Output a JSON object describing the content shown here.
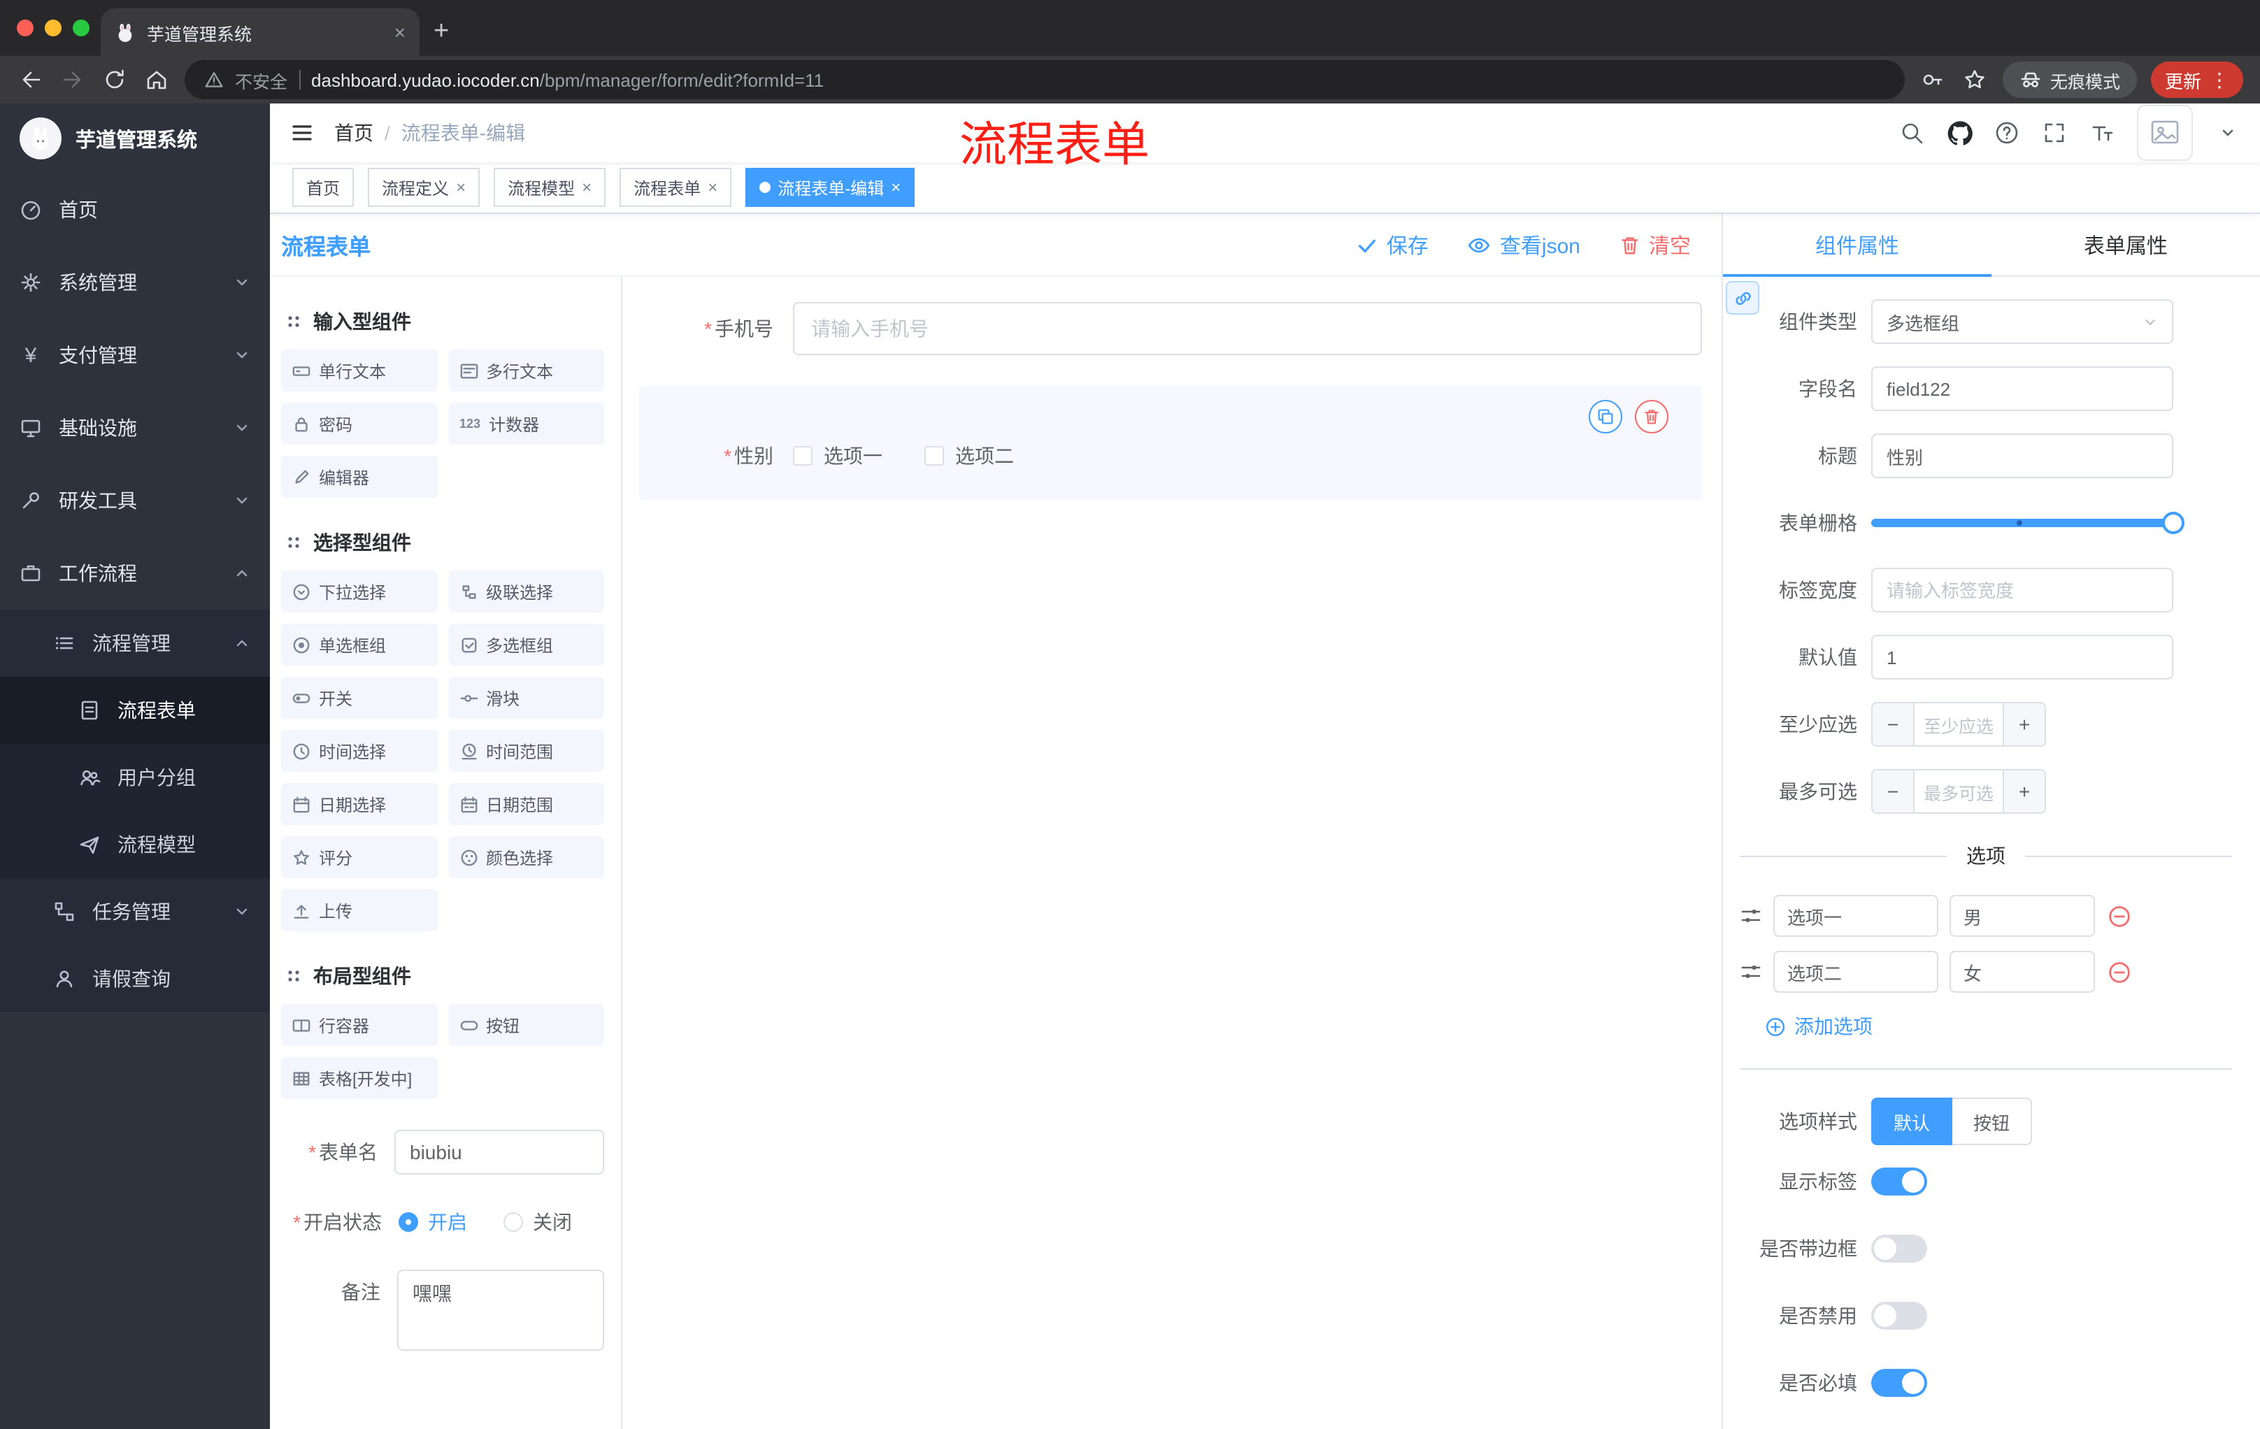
{
  "glyphs": {
    "close": "×",
    "plus": "+",
    "menu": "⋮",
    "minus": "−",
    "required": "*",
    "question": "?"
  },
  "colors": {
    "accent": "#409eff",
    "danger": "#f56c6c",
    "annotation_red": "#fb2016"
  },
  "browser": {
    "tab_title": "芋道管理系统",
    "security_label": "不安全",
    "url_host": "dashboard.yudao.iocoder.cn",
    "url_path": "/bpm/manager/form/edit?formId=11",
    "incognito_label": "无痕模式",
    "update_label": "更新"
  },
  "sidebar": {
    "logo_title": "芋道管理系统",
    "items": [
      {
        "label": "首页"
      },
      {
        "label": "系统管理"
      },
      {
        "label": "支付管理"
      },
      {
        "label": "基础设施"
      },
      {
        "label": "研发工具"
      },
      {
        "label": "工作流程"
      },
      {
        "label": "流程管理"
      },
      {
        "label": "流程表单"
      },
      {
        "label": "用户分组"
      },
      {
        "label": "流程模型"
      },
      {
        "label": "任务管理"
      },
      {
        "label": "请假查询"
      }
    ]
  },
  "header": {
    "breadcrumb_home": "首页",
    "breadcrumb_separator": "/",
    "breadcrumb_current": "流程表单-编辑",
    "annotation": "流程表单"
  },
  "tags": [
    {
      "label": "首页"
    },
    {
      "label": "流程定义"
    },
    {
      "label": "流程模型"
    },
    {
      "label": "流程表单"
    },
    {
      "label": "流程表单-编辑"
    }
  ],
  "designer": {
    "title": "流程表单",
    "save_label": "保存",
    "view_json_label": "查看json",
    "clear_label": "清空"
  },
  "palette": {
    "sections": [
      {
        "title": "输入型组件",
        "items": [
          "单行文本",
          "多行文本",
          "密码",
          "计数器",
          "编辑器"
        ]
      },
      {
        "title": "选择型组件",
        "items": [
          "下拉选择",
          "级联选择",
          "单选框组",
          "多选框组",
          "开关",
          "滑块",
          "时间选择",
          "时间范围",
          "日期选择",
          "日期范围",
          "评分",
          "颜色选择",
          "上传"
        ]
      },
      {
        "title": "布局型组件",
        "items": [
          "行容器",
          "按钮",
          "表格[开发中]"
        ]
      }
    ],
    "counter_icon_text": "123"
  },
  "meta_form": {
    "name_label": "表单名",
    "name_value": "biubiu",
    "status_label": "开启状态",
    "status_on": "开启",
    "status_off": "关闭",
    "remark_label": "备注",
    "remark_value": "嘿嘿"
  },
  "canvas": {
    "phone_label": "手机号",
    "phone_placeholder": "请输入手机号",
    "gender_label": "性别",
    "gender_option1": "选项一",
    "gender_option2": "选项二"
  },
  "props": {
    "tabs": [
      {
        "label": "组件属性"
      },
      {
        "label": "表单属性"
      }
    ],
    "component_type_label": "组件类型",
    "component_type_value": "多选框组",
    "field_name_label": "字段名",
    "field_name_value": "field122",
    "title_label": "标题",
    "title_value": "性别",
    "grid_label": "表单栅格",
    "label_width_label": "标签宽度",
    "label_width_placeholder": "请输入标签宽度",
    "default_label": "默认值",
    "default_value": "1",
    "min_label": "至少应选",
    "min_placeholder": "至少应选",
    "max_label": "最多可选",
    "max_placeholder": "最多可选",
    "options_divider": "选项",
    "options": [
      {
        "label": "选项一",
        "value": "男"
      },
      {
        "label": "选项二",
        "value": "女"
      }
    ],
    "add_option_label": "添加选项",
    "style_label": "选项样式",
    "style_default": "默认",
    "style_button": "按钮",
    "switches": [
      {
        "label": "显示标签",
        "on": true
      },
      {
        "label": "是否带边框",
        "on": false
      },
      {
        "label": "是否禁用",
        "on": false
      },
      {
        "label": "是否必填",
        "on": true
      }
    ]
  }
}
